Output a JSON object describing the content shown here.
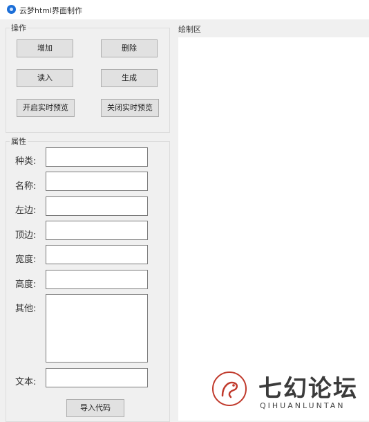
{
  "window": {
    "title": "云梦html界面制作"
  },
  "operations": {
    "label": "操作",
    "buttons": {
      "add": "增加",
      "delete": "删除",
      "read": "读入",
      "generate": "生成",
      "start_preview": "开启实时预览",
      "stop_preview": "关闭实时预览"
    }
  },
  "properties": {
    "label": "属性",
    "fields": {
      "type": {
        "label": "种类:",
        "value": ""
      },
      "name": {
        "label": "名称:",
        "value": ""
      },
      "left": {
        "label": "左边:",
        "value": ""
      },
      "top": {
        "label": "顶边:",
        "value": ""
      },
      "width": {
        "label": "宽度:",
        "value": ""
      },
      "height": {
        "label": "高度:",
        "value": ""
      },
      "other": {
        "label": "其他:",
        "value": ""
      },
      "text": {
        "label": "文本:",
        "value": ""
      }
    },
    "import_button": "导入代码"
  },
  "canvas": {
    "label": "绘制区"
  },
  "watermark": {
    "name": "七幻论坛",
    "pinyin": "QIHUANLUNTAN"
  },
  "colors": {
    "accent": "#1c6fd8",
    "watermark": "#c0392b"
  }
}
